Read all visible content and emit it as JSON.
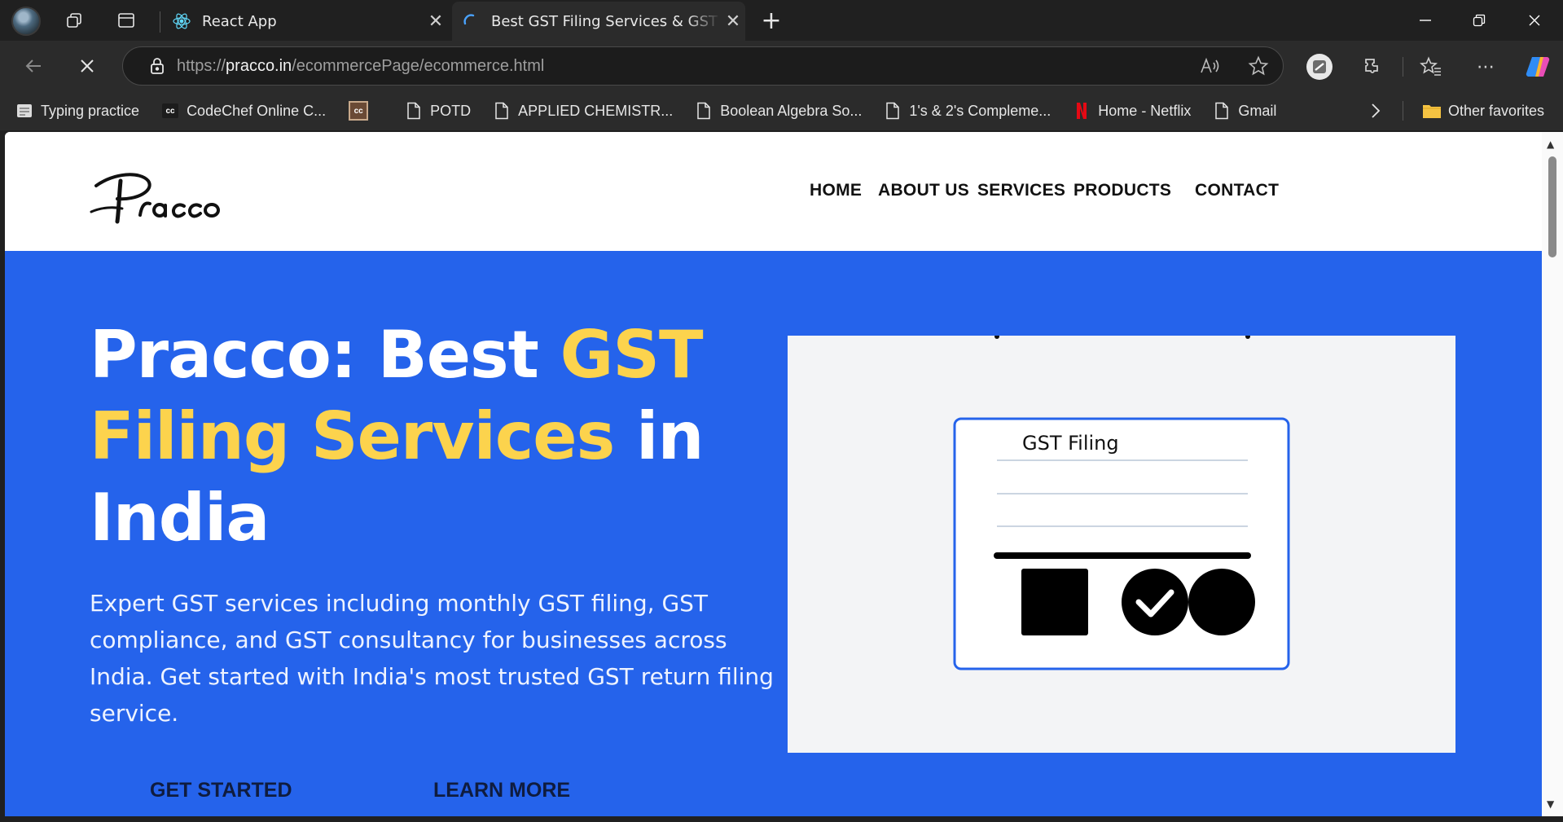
{
  "browser": {
    "tabs": [
      {
        "label": "React App",
        "icon": "react-icon",
        "active": false
      },
      {
        "label": "Best GST Filing Services & GST Co",
        "icon": "loading-spinner-icon",
        "active": true
      }
    ],
    "url_prefix": "https://",
    "url_domain": "pracco.in",
    "url_path": "/ecommercePage/ecommerce.html",
    "favorites": [
      {
        "label": "Typing practice",
        "icon": "typing-icon"
      },
      {
        "label": "CodeChef Online C...",
        "icon": "codechef-icon"
      },
      {
        "label": "",
        "icon": "codechef-box-icon"
      },
      {
        "label": "POTD",
        "icon": "page-icon"
      },
      {
        "label": "APPLIED CHEMISTR...",
        "icon": "page-icon"
      },
      {
        "label": "Boolean Algebra So...",
        "icon": "page-icon"
      },
      {
        "label": "1's & 2's Compleme...",
        "icon": "page-icon"
      },
      {
        "label": "Home - Netflix",
        "icon": "netflix-icon"
      },
      {
        "label": "Gmail",
        "icon": "page-icon"
      }
    ],
    "other_favorites": "Other favorites"
  },
  "site": {
    "logo_text": "Pracco",
    "nav": [
      "HOME",
      "ABOUT US",
      "SERVICES",
      "PRODUCTS",
      "CONTACT"
    ],
    "hero": {
      "title_part1": "Pracco: Best ",
      "title_highlight1": "GST",
      "title_highlight2": "Filing Services",
      "title_part2": " in",
      "title_part3": "India",
      "subtitle": "Expert GST services including monthly GST filing, GST compliance, and GST consultancy for businesses across India. Get started with India's most trusted GST return filing service.",
      "cta_primary": "GET STARTED",
      "cta_secondary": "LEARN MORE"
    },
    "illustration": {
      "doc_label": "GST Filing"
    }
  },
  "colors": {
    "hero_bg": "#2563eb",
    "highlight": "#fcd34d",
    "illustration_bg": "#f3f4f6",
    "doc_border": "#2563eb"
  }
}
